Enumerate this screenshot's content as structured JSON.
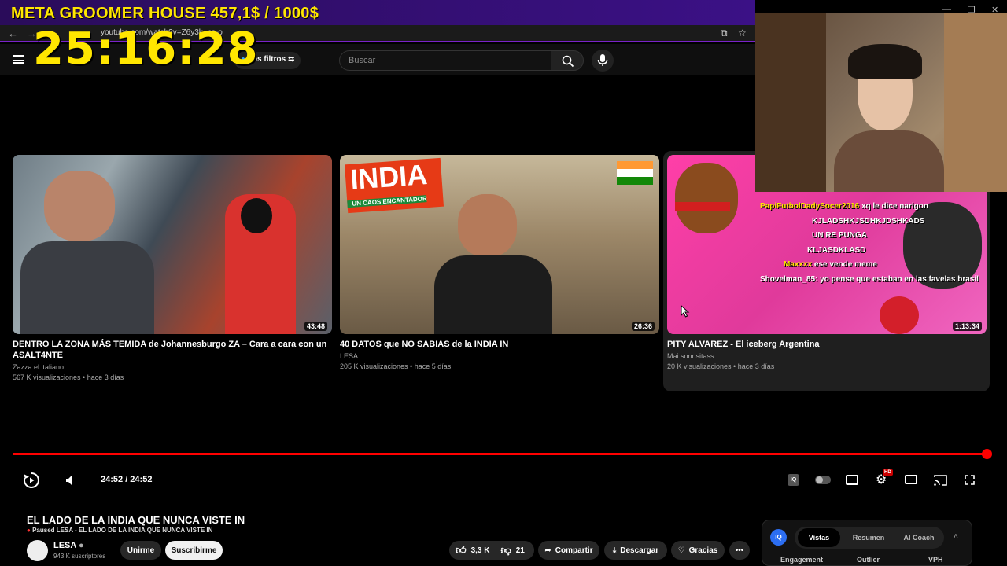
{
  "overlay": {
    "title": "META GROOMER HOUSE 457,1$ / 1000$",
    "timer": "25:16:28"
  },
  "browser": {
    "url": "youtube.com/watch?v=Z6y3k_bs-o",
    "back": "←",
    "forward": "→",
    "star": "☆"
  },
  "header": {
    "filters_label": "Los filtros",
    "search_placeholder": "Buscar"
  },
  "videos": [
    {
      "title": "DENTRO LA ZONA MÁS TEMIDA de Johannesburgo ZA – Cara a cara con un ASALT4NTE",
      "channel": "Zazza el italiano",
      "meta": "567 K visualizaciones • hace 3 días",
      "duration": "43:48"
    },
    {
      "title": "40 DATOS que NO SABIAS de la INDIA IN",
      "channel": "LESA",
      "meta": "205 K visualizaciones • hace 5 días",
      "duration": "26:36",
      "banner": "INDIA",
      "banner_sub": "UN CAOS ENCANTADOR"
    },
    {
      "title": "PITY ALVAREZ - El iceberg Argentina",
      "channel": "Mai sonrisitass",
      "meta": "20 K visualizaciones • hace 3 días",
      "duration": "1:13:34"
    }
  ],
  "chat": [
    {
      "user": "PapiFutbolDadySocer2016",
      "text": "xq le dice narigon"
    },
    {
      "user": "",
      "text": "KJLADSHKJSDHKJDSHKADS"
    },
    {
      "user": "",
      "text": "UN RE PUNGA"
    },
    {
      "user": "",
      "text": "KLJASDKLASD"
    },
    {
      "user": "Maxxxx",
      "text": "ese vende meme"
    },
    {
      "user": "Shovelman_85:",
      "text": "yo pense que estaban en las favelas brasil"
    }
  ],
  "player": {
    "time": "24:52 / 24:52",
    "progress": 1.0,
    "hd_badge": "HD"
  },
  "info": {
    "title": "EL LADO DE LA INDIA QUE NUNCA VISTE IN",
    "paused": "Paused LESA - EL LADO DE LA INDIA QUE NUNCA VISTE IN",
    "channel": "LESA",
    "subs": "943 K suscriptores",
    "join": "Unirme",
    "subscribe": "Suscribirme",
    "likes": "3,3 K",
    "dislikes": "21",
    "share": "Compartir",
    "download": "Descargar",
    "thanks": "Gracias"
  },
  "panel": {
    "badge": "IQ",
    "tabs": [
      "Vistas",
      "Resumen",
      "AI Coach"
    ],
    "stats": [
      "Engagement",
      "Outlier",
      "VPH"
    ]
  },
  "colors": {
    "accent": "#ff0000",
    "overlay_yellow": "#ffe600",
    "overlay_purple": "#3b1186"
  }
}
